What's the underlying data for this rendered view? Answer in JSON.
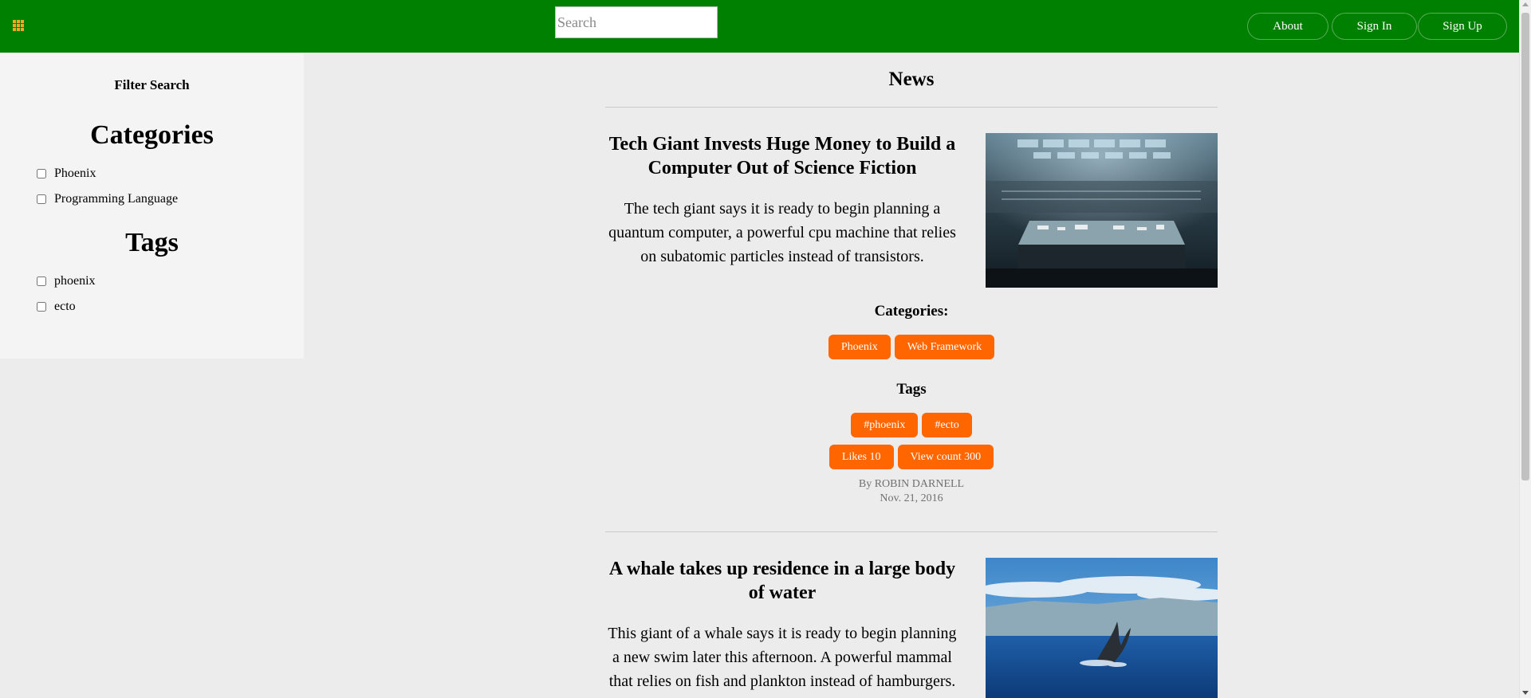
{
  "header": {
    "menu_icon": "grid-icon",
    "search_placeholder": "Search",
    "nav": {
      "about": "About",
      "sign_in": "Sign In",
      "sign_up": "Sign Up"
    }
  },
  "sidebar": {
    "filter_title": "Filter Search",
    "categories_heading": "Categories",
    "categories": [
      "Phoenix",
      "Programming Language"
    ],
    "tags_heading": "Tags",
    "tags": [
      "phoenix",
      "ecto"
    ]
  },
  "main": {
    "title": "News",
    "articles": [
      {
        "title": "Tech Giant Invests Huge Money to Build a Computer Out of Science Fiction",
        "body": "The tech giant says it is ready to begin planning a quantum computer, a powerful cpu machine that relies on subatomic particles instead of transistors.",
        "categories_label": "Categories:",
        "categories": [
          "Phoenix",
          "Web Framework"
        ],
        "tags_label": "Tags",
        "tags": [
          "#phoenix",
          "#ecto"
        ],
        "likes": "Likes 10",
        "views": "View count 300",
        "author": "By ROBIN DARNELL",
        "date": "Nov. 21, 2016"
      },
      {
        "title": "A whale takes up residence in a large body of water",
        "body": "This giant of a whale says it is ready to begin planning a new swim later this afternoon. A powerful mammal that relies on fish and plankton instead of hamburgers."
      }
    ]
  },
  "colors": {
    "header_bg": "#008000",
    "pill_bg": "#ff6600",
    "menu_icon": "#f5a623"
  }
}
